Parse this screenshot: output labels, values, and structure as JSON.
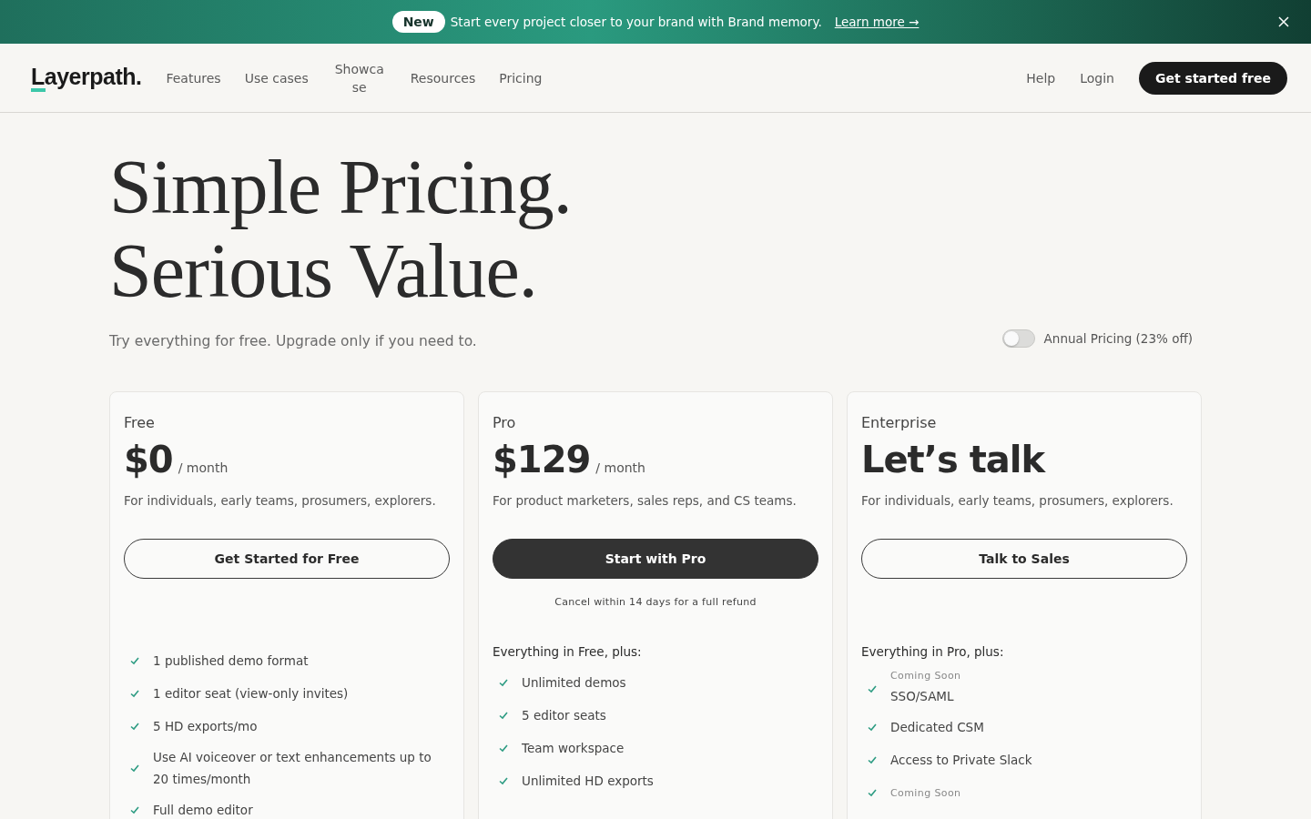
{
  "banner": {
    "badge": "New",
    "message": "Start every project closer to your brand with Brand memory.",
    "link": "Learn more →"
  },
  "nav": {
    "logo": "Layerpath.",
    "links": [
      "Features",
      "Use cases",
      "Showcase",
      "Resources",
      "Pricing"
    ],
    "right_links": [
      "Help",
      "Login"
    ],
    "cta": "Get started free"
  },
  "hero": {
    "title_lines": [
      "Simple Pricing.",
      "Serious Value."
    ],
    "subtitle": "Try everything for free. Upgrade only if you need to.",
    "toggle": {
      "label": "Annual Pricing (23% off)",
      "on": false
    }
  },
  "plans": [
    {
      "name": "Free",
      "price": "$0",
      "period": "/ month",
      "description": "For individuals, early teams, prosumers, explorers.",
      "button": {
        "label": "Get Started for Free",
        "kind": "outline"
      },
      "features": [
        {
          "text": "1 published demo format"
        },
        {
          "text": "1 editor seat (view-only invites)"
        },
        {
          "text": "5 HD exports/mo"
        },
        {
          "text": "Use AI voiceover or text enhancements up to 20 times/month"
        },
        {
          "text": "Full demo editor"
        }
      ]
    },
    {
      "name": "Pro",
      "price": "$129",
      "period": "/ month",
      "description": "For product marketers, sales reps, and CS teams.",
      "button": {
        "label": "Start with Pro",
        "kind": "filled"
      },
      "note": "Cancel within 14 days for a full refund",
      "features_heading": "Everything in Free, plus:",
      "features": [
        {
          "text": "Unlimited demos"
        },
        {
          "text": "5 editor seats"
        },
        {
          "text": "Team workspace"
        },
        {
          "text": "Unlimited HD exports"
        }
      ]
    },
    {
      "name": "Enterprise",
      "price": "Let’s talk",
      "description": "For individuals, early teams, prosumers, explorers.",
      "button": {
        "label": "Talk to Sales",
        "kind": "outline"
      },
      "features_heading": "Everything in Pro, plus:",
      "features": [
        {
          "tag": "Coming Soon",
          "text": "SSO/SAML"
        },
        {
          "text": "Dedicated CSM"
        },
        {
          "text": "Access to Private Slack"
        },
        {
          "tag": "Coming Soon"
        }
      ]
    }
  ]
}
